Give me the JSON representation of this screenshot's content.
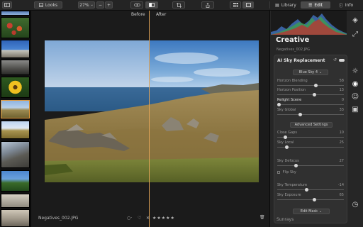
{
  "toolbar": {
    "looks_label": "Looks",
    "zoom_value": "27%",
    "library_label": "Library",
    "edit_label": "Edit",
    "info_label": "Info"
  },
  "canvas": {
    "before_label": "Before",
    "after_label": "After",
    "filename": "Negatives_002.JPG",
    "rating_stars": "★★★★★"
  },
  "panel": {
    "section_title": "Creative",
    "file_subtitle": "Negatives_002.JPG",
    "tool_title": "AI Sky Replacement",
    "sky_select": "Blue Sky 4",
    "advanced_button": "Advanced Settings",
    "flip_sky_label": "Flip Sky",
    "edit_mask_button": "Edit Mask",
    "next_section": "Sunrays",
    "sliders_top": [
      {
        "label": "Horizon Blending",
        "value": "58",
        "pos": 0.58
      },
      {
        "label": "Horizon Position",
        "value": "13",
        "pos": 0.56
      },
      {
        "label": "Relight Scene",
        "value": "0",
        "pos": 0.0
      },
      {
        "label": "Sky Global",
        "value": "33",
        "pos": 0.33
      }
    ],
    "sliders_adv": [
      {
        "label": "Close Gaps",
        "value": "10",
        "pos": 0.1
      },
      {
        "label": "Sky Local",
        "value": "25",
        "pos": 0.12
      },
      {
        "label": "Sky Defocus",
        "value": "27",
        "pos": 0.27
      },
      {
        "label": "Sky Temperature",
        "value": "-14",
        "pos": 0.43
      },
      {
        "label": "Sky Exposure",
        "value": "65",
        "pos": 0.55
      }
    ]
  },
  "colors": {
    "accent": "#e2a457",
    "panel_bg": "#262626",
    "card_bg": "#303030"
  }
}
